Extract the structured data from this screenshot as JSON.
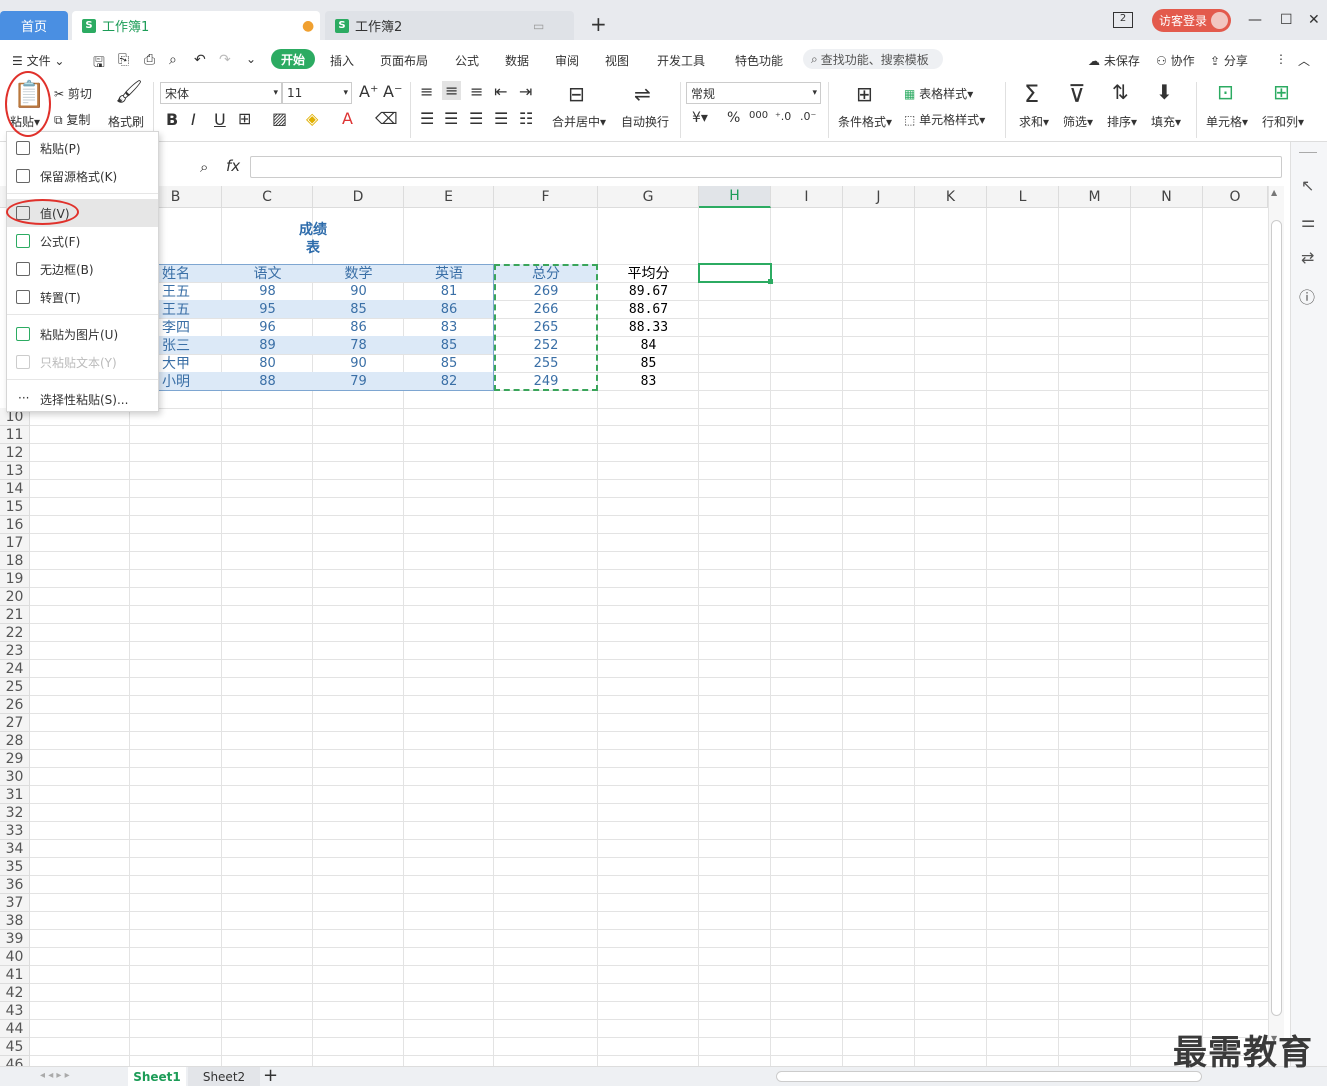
{
  "tabs": {
    "home": "首页",
    "workbook1": "工作簿1",
    "workbook2": "工作簿2"
  },
  "title_bar": {
    "login": "访客登录",
    "window_count": "2"
  },
  "menu": {
    "file": "文件",
    "items": [
      "开始",
      "插入",
      "页面布局",
      "公式",
      "数据",
      "审阅",
      "视图",
      "开发工具",
      "特色功能"
    ],
    "search_placeholder": "查找功能、搜索模板",
    "unsaved": "未保存",
    "collab": "协作",
    "share": "分享"
  },
  "toolbar": {
    "paste": "粘贴",
    "cut": "剪切",
    "copy": "复制",
    "format_painter": "格式刷",
    "font_name": "宋体",
    "font_size": "11",
    "merge_center": "合并居中",
    "wrap": "自动换行",
    "number_format": "常规",
    "cond_format": "条件格式",
    "table_style": "表格样式",
    "cell_style": "单元格样式",
    "sum": "求和",
    "filter": "筛选",
    "sort": "排序",
    "fill": "填充",
    "cell": "单元格",
    "row_col": "行和列",
    "bold": "B",
    "italic": "I",
    "underline": "U",
    "currency": "¥",
    "percent": "%",
    "thousands": "000"
  },
  "formula_bar": {
    "fx": "fx",
    "value": ""
  },
  "columns": [
    "B",
    "C",
    "D",
    "E",
    "F",
    "G",
    "H",
    "I",
    "J",
    "K",
    "L",
    "M",
    "N",
    "O"
  ],
  "rows": [
    "10",
    "11",
    "12",
    "13",
    "14",
    "15",
    "16",
    "17",
    "18",
    "19",
    "20",
    "21",
    "22",
    "23",
    "24",
    "25",
    "26",
    "27",
    "28",
    "29",
    "30",
    "31",
    "32",
    "33",
    "34",
    "35",
    "36",
    "37",
    "38",
    "39",
    "40",
    "41",
    "42",
    "43",
    "44",
    "45",
    "46"
  ],
  "sheet": {
    "title_line1": "成绩",
    "title_line2": "表",
    "headers": [
      "姓名",
      "语文",
      "数学",
      "英语",
      "总分",
      "平均分"
    ],
    "rows": [
      [
        "王五",
        "98",
        "90",
        "81",
        "269",
        "89.67"
      ],
      [
        "王五",
        "95",
        "85",
        "86",
        "266",
        "88.67"
      ],
      [
        "李四",
        "96",
        "86",
        "83",
        "265",
        "88.33"
      ],
      [
        "张三",
        "89",
        "78",
        "85",
        "252",
        "84"
      ],
      [
        "大甲",
        "80",
        "90",
        "85",
        "255",
        "85"
      ],
      [
        "小明",
        "88",
        "79",
        "82",
        "249",
        "83"
      ]
    ]
  },
  "paste_menu": {
    "items": [
      "粘贴(P)",
      "保留源格式(K)",
      "值(V)",
      "公式(F)",
      "无边框(B)",
      "转置(T)",
      "粘贴为图片(U)",
      "只粘贴文本(Y)",
      "选择性粘贴(S)..."
    ]
  },
  "sheet_tabs": [
    "Sheet1",
    "Sheet2"
  ],
  "watermark": "最需教育",
  "colors": {
    "accent_green": "#2cab62",
    "tab_blue": "#4a8fe2",
    "login_red": "#e35a4c",
    "highlight_red": "#e0312b",
    "table_band": "#dce9f7"
  }
}
